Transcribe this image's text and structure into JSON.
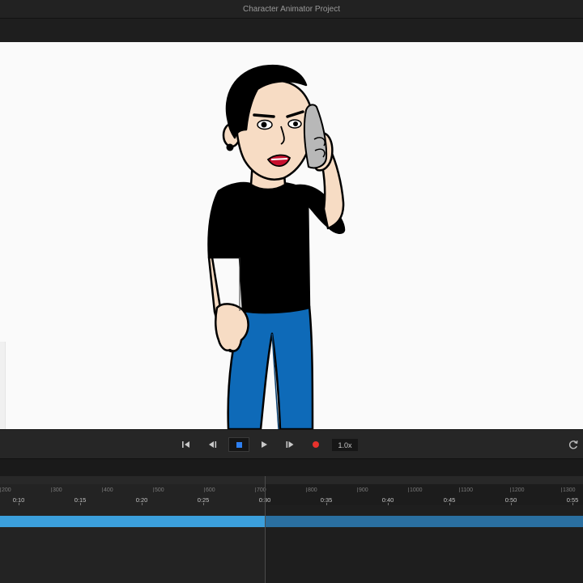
{
  "window": {
    "title": "Character Animator Project"
  },
  "transport": {
    "speed": "1.0x"
  },
  "timeline": {
    "frame_labels": [
      "200",
      "300",
      "400",
      "500",
      "600",
      "700",
      "800",
      "900",
      "1000",
      "1100",
      "1200",
      "1300"
    ],
    "time_labels": [
      "0:10",
      "0:15",
      "0:20",
      "0:25",
      "0:30",
      "0:35",
      "0:40",
      "0:45",
      "0:50",
      "0:55"
    ],
    "playhead_time": "0:30",
    "progress_fraction": 0.455
  },
  "colors": {
    "accent": "#3b9fdc",
    "record": "#e8322c",
    "stop": "#2d7ff0"
  },
  "icons": [
    "go-to-start-icon",
    "step-back-icon",
    "stop-icon",
    "play-icon",
    "step-forward-icon",
    "record-icon",
    "refresh-icon"
  ]
}
